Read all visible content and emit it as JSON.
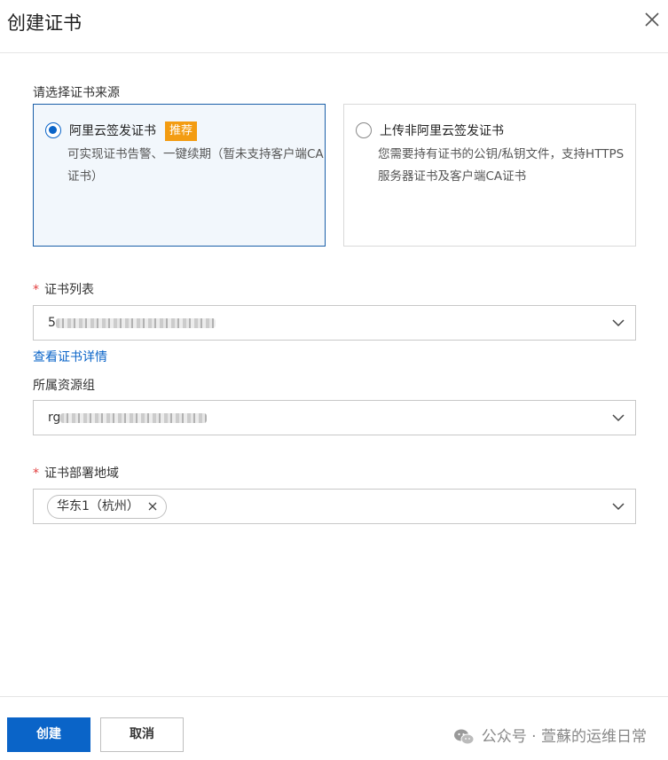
{
  "dialog": {
    "title": "创建证书"
  },
  "source": {
    "label": "请选择证书来源",
    "options": [
      {
        "title": "阿里云签发证书",
        "badge": "推荐",
        "description": "可实现证书告警、一键续期（暂未支持客户端CA证书）",
        "selected": true
      },
      {
        "title": "上传非阿里云签发证书",
        "description": "您需要持有证书的公钥/私钥文件，支持HTTPS服务器证书及客户端CA证书",
        "selected": false
      }
    ]
  },
  "cert_list": {
    "label": "证书列表",
    "required": true,
    "value_prefix": "5"
  },
  "detail_link": "查看证书详情",
  "resource_group": {
    "label": "所属资源组",
    "value_prefix": "rg"
  },
  "region": {
    "label": "证书部署地域",
    "required": true,
    "tags": [
      "华东1（杭州）"
    ]
  },
  "footer": {
    "create_label": "创建",
    "cancel_label": "取消",
    "watermark": "公众号 · 萱蘇的运维日常"
  },
  "colors": {
    "primary": "#0a64c8",
    "badge": "#f39c12",
    "required": "#e23d3d",
    "selected_bg": "#f2f7fc"
  },
  "icons": {
    "close": "close-icon",
    "chevron": "chevron-down-icon",
    "wechat": "wechat-icon"
  }
}
